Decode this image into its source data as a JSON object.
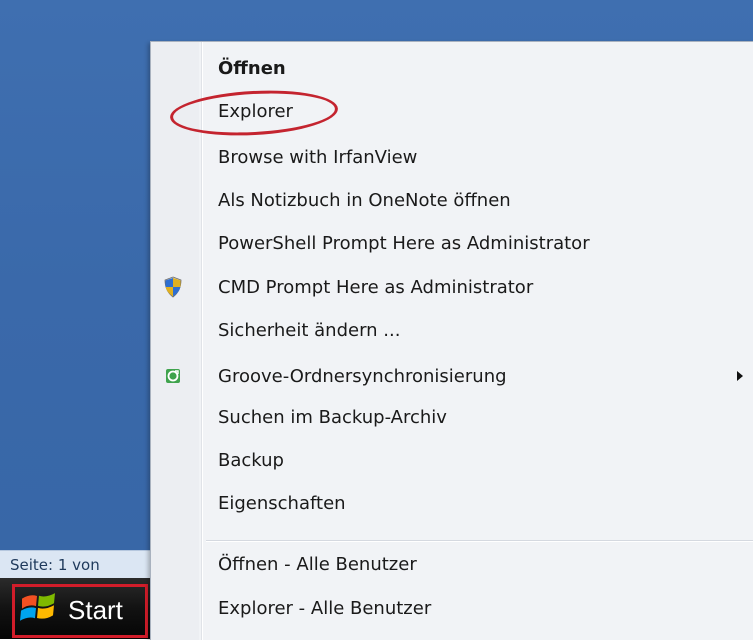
{
  "status_bar": {
    "text": "Seite: 1 von"
  },
  "taskbar": {
    "start_label": "Start"
  },
  "context_menu": {
    "items": [
      {
        "label": "Öffnen",
        "bold": true
      },
      {
        "label": "Explorer"
      },
      {
        "label": "Browse with IrfanView"
      },
      {
        "label": "Als Notizbuch in OneNote öffnen"
      },
      {
        "label": "PowerShell Prompt Here as Administrator"
      },
      {
        "label": "CMD Prompt Here as Administrator",
        "icon": "uac-shield-icon"
      },
      {
        "label": "Sicherheit ändern ..."
      },
      {
        "label": "Groove-Ordnersynchronisierung",
        "icon": "groove-icon",
        "submenu": true
      },
      {
        "label": "Suchen im Backup-Archiv"
      },
      {
        "label": "Backup"
      },
      {
        "label": "Eigenschaften"
      },
      {
        "label": "Öffnen - Alle Benutzer"
      },
      {
        "label": "Explorer - Alle Benutzer"
      }
    ]
  },
  "annotations": {
    "circle_color": "#c4242f",
    "box_color": "#d21d2a"
  }
}
